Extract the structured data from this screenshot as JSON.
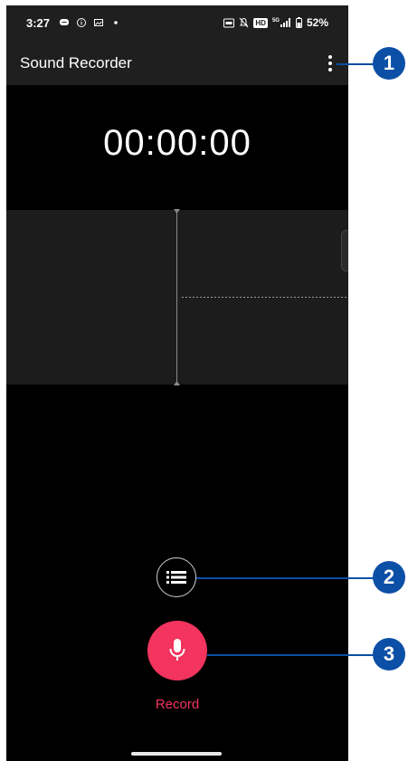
{
  "status_bar": {
    "time": "3:27",
    "battery": "52%",
    "network": "5G",
    "hd_badge": "HD"
  },
  "app_bar": {
    "title": "Sound Recorder",
    "menu_icon": "more-vert-icon"
  },
  "recorder": {
    "timer": "00:00:00",
    "record_label": "Record"
  },
  "callouts": [
    "1",
    "2",
    "3"
  ],
  "colors": {
    "accent": "#f2345e",
    "callout": "#0b4fa6",
    "app_bar_bg": "#1f1f1f",
    "waveform_bg": "#1c1c1c"
  }
}
